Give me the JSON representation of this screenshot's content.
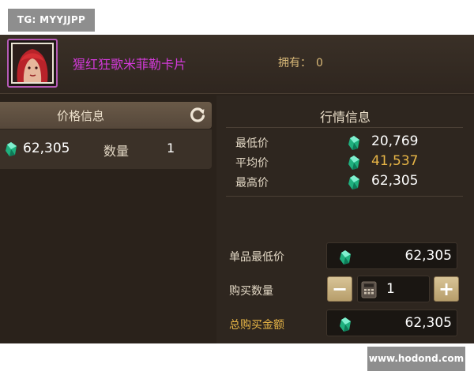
{
  "watermark": {
    "top_left": "TG: MYYJJPP",
    "bottom_right": "www.hodond.com"
  },
  "header": {
    "card_name": "猩红狂歌米菲勒卡片",
    "owned_label": "拥有：",
    "owned_value": "0"
  },
  "price_panel": {
    "title": "价格信息",
    "price": "62,305",
    "qty_label": "数量",
    "qty_value": "1"
  },
  "market_panel": {
    "title": "行情信息",
    "stats": [
      {
        "label": "最低价",
        "value": "20,769"
      },
      {
        "label": "平均价",
        "value": "41,537"
      },
      {
        "label": "最高价",
        "value": "62,305"
      }
    ]
  },
  "purchase": {
    "unit_min_label": "单品最低价",
    "unit_min_value": "62,305",
    "qty_label": "购买数量",
    "qty_value": "1",
    "minus": "−",
    "plus": "+",
    "total_label": "总购买金额",
    "total_value": "62,305"
  },
  "colors": {
    "gold": "#e7b546",
    "magenta": "#d23ad8",
    "gem": "#3fd2a6"
  },
  "icons": [
    "gem-icon",
    "refresh-icon",
    "calculator-icon",
    "minus-icon",
    "plus-icon"
  ]
}
